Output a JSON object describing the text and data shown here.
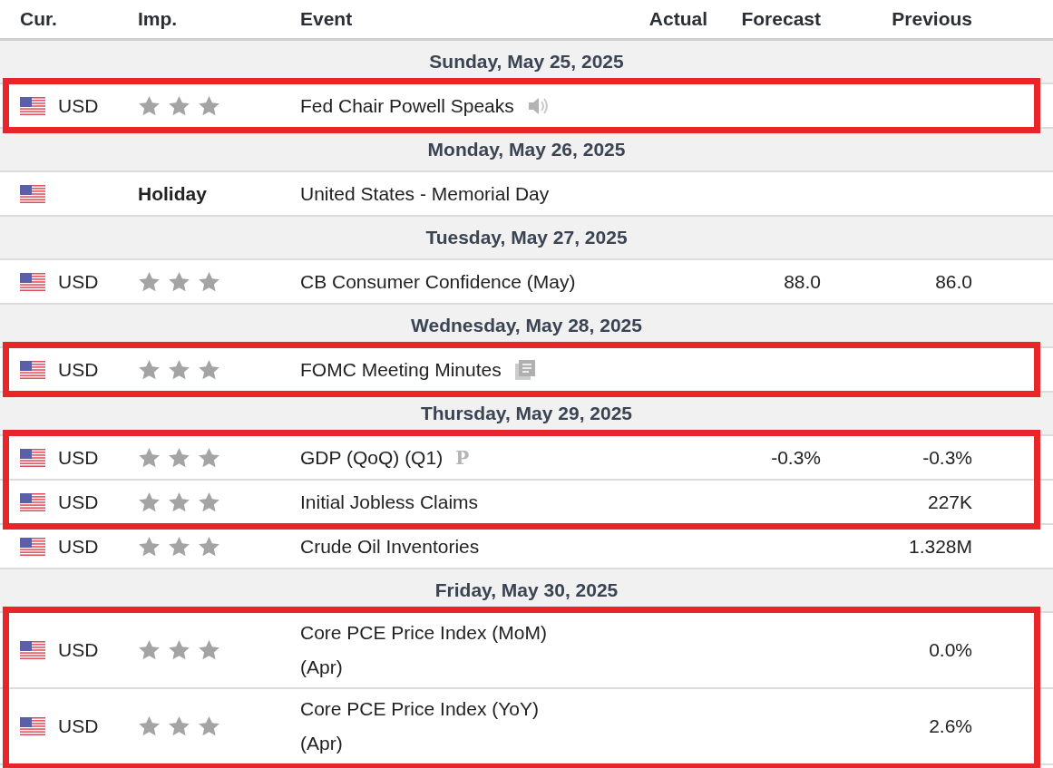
{
  "columns": [
    "Cur.",
    "Imp.",
    "Event",
    "Actual",
    "Forecast",
    "Previous"
  ],
  "days": [
    {
      "date": "Sunday, May 25, 2025",
      "groups": [
        {
          "highlighted": true,
          "events": [
            {
              "currency": "USD",
              "stars": 3,
              "event": "Fed Chair Powell Speaks",
              "kind": "speaker"
            }
          ]
        }
      ]
    },
    {
      "date": "Monday, May 26, 2025",
      "groups": [
        {
          "highlighted": false,
          "events": [
            {
              "importance_text": "Holiday",
              "event": "United States - Memorial Day"
            }
          ]
        }
      ]
    },
    {
      "date": "Tuesday, May 27, 2025",
      "groups": [
        {
          "highlighted": false,
          "events": [
            {
              "currency": "USD",
              "stars": 3,
              "event": "CB Consumer Confidence (May)",
              "forecast": "88.0",
              "previous": "86.0"
            }
          ]
        }
      ]
    },
    {
      "date": "Wednesday, May 28, 2025",
      "groups": [
        {
          "highlighted": true,
          "events": [
            {
              "currency": "USD",
              "stars": 3,
              "event": "FOMC Meeting Minutes",
              "kind": "document"
            }
          ]
        }
      ]
    },
    {
      "date": "Thursday, May 29, 2025",
      "groups": [
        {
          "highlighted": true,
          "events": [
            {
              "currency": "USD",
              "stars": 3,
              "event": "GDP (QoQ) (Q1)",
              "kind": "preliminary",
              "icon_text": "P",
              "forecast": "-0.3%",
              "previous": "-0.3%"
            },
            {
              "currency": "USD",
              "stars": 3,
              "event": "Initial Jobless Claims",
              "previous": "227K"
            }
          ]
        },
        {
          "highlighted": false,
          "events": [
            {
              "currency": "USD",
              "stars": 3,
              "event": "Crude Oil Inventories",
              "previous": "1.328M"
            }
          ]
        }
      ]
    },
    {
      "date": "Friday, May 30, 2025",
      "groups": [
        {
          "highlighted": true,
          "events": [
            {
              "currency": "USD",
              "stars": 3,
              "event": "Core PCE Price Index (MoM) (Apr)",
              "previous": "0.0%"
            },
            {
              "currency": "USD",
              "stars": 3,
              "event": "Core PCE Price Index (YoY) (Apr)",
              "previous": "2.6%"
            }
          ]
        }
      ]
    }
  ]
}
